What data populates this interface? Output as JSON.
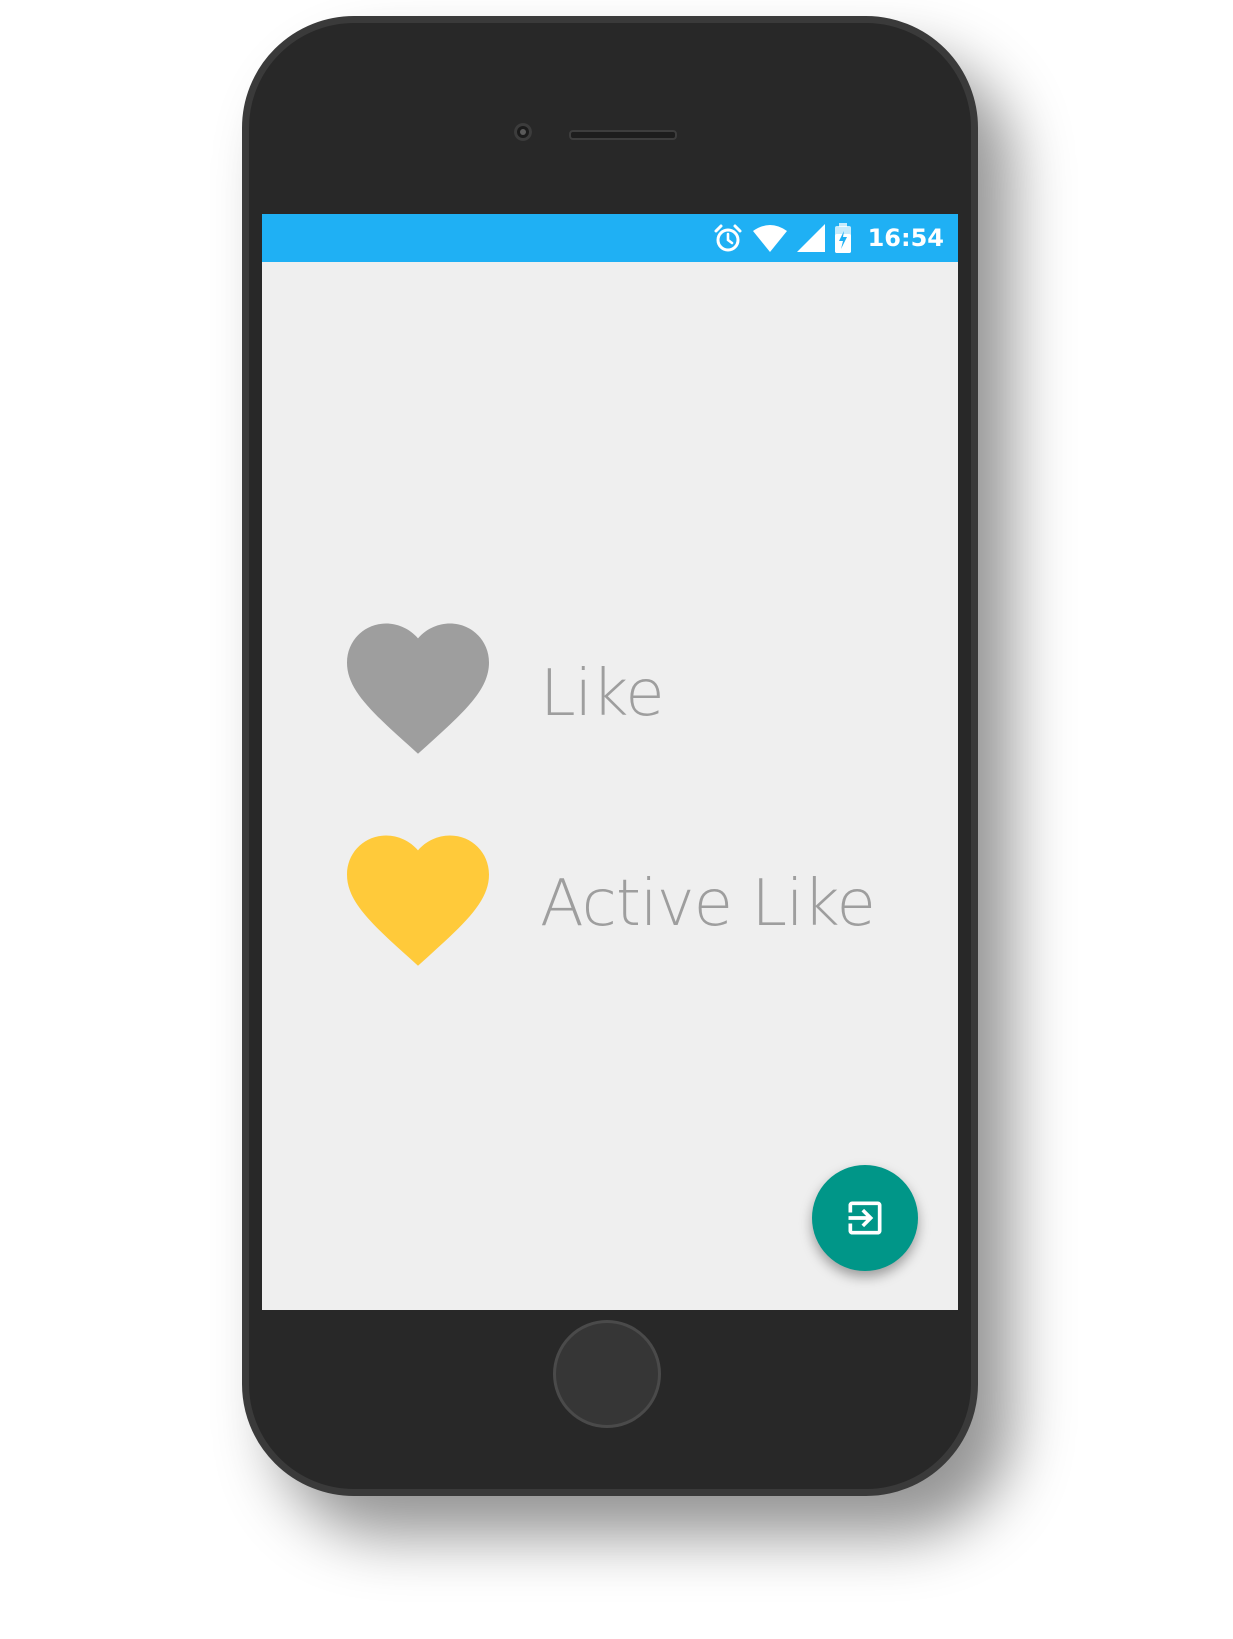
{
  "status_bar": {
    "time": "16:54",
    "icons": [
      "alarm-icon",
      "wifi-icon",
      "cell-signal-icon",
      "battery-charging-icon"
    ],
    "background": "#1fb0f4"
  },
  "items": [
    {
      "label": "Like",
      "icon": "heart-icon",
      "color": "#9e9e9e",
      "active": false
    },
    {
      "label": "Active Like",
      "icon": "heart-icon",
      "color": "#ffca3a",
      "active": true
    }
  ],
  "fab": {
    "icon": "exit-to-app-icon",
    "color": "#009688"
  },
  "colors": {
    "screen_background": "#efefef",
    "label_text": "#9e9e9e",
    "device_body": "#282828"
  }
}
